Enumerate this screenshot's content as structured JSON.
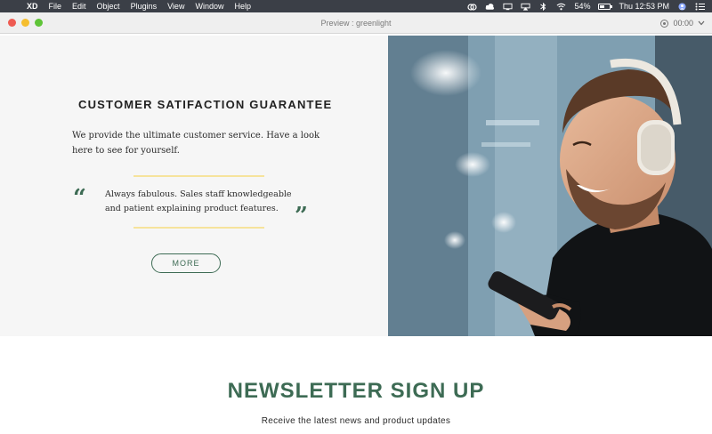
{
  "menubar": {
    "apple_icon": "apple-icon",
    "app_name": "XD",
    "items": [
      "File",
      "Edit",
      "Object",
      "Plugins",
      "View",
      "Window",
      "Help"
    ],
    "battery_percent": "54%",
    "battery_level": 0.54,
    "clock": "Thu 12:53 PM"
  },
  "window": {
    "title": "Preview : greenlight",
    "recording_time": "00:00"
  },
  "hero": {
    "title": "CUSTOMER SATIFACTION GUARANTEE",
    "body": "We provide the ultimate customer service. Have a look here to see for yourself.",
    "open_quote": "“",
    "close_quote": "”",
    "testimonial": "Always fabulous. Sales staff knowledgeable and patient explaining product features.",
    "more_label": "MORE"
  },
  "newsletter": {
    "title": "NEWSLETTER SIGN UP",
    "subtitle": "Receive the latest news and product updates"
  },
  "colors": {
    "accent_green": "#3d6b54",
    "rule_yellow": "#f6e39c",
    "menubar_bg": "#3b3f47"
  }
}
